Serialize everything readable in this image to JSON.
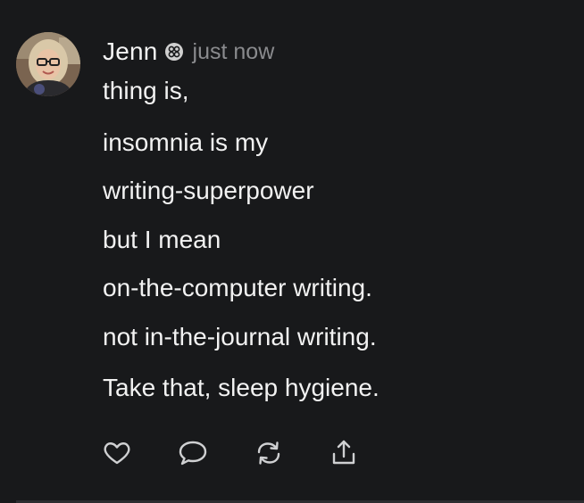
{
  "post": {
    "author": "Jenn",
    "badge_icon": "verified-badge-icon",
    "timestamp": "just now",
    "lines": [
      "thing is,",
      "insomnia is my",
      "writing-superpower",
      "but I mean",
      "on-the-computer writing.",
      "not in-the-journal writing.",
      "Take that, sleep hygiene."
    ]
  },
  "actions": [
    {
      "name": "like",
      "icon": "heart-icon"
    },
    {
      "name": "reply",
      "icon": "speech-bubble-icon"
    },
    {
      "name": "repost",
      "icon": "repost-icon"
    },
    {
      "name": "share",
      "icon": "share-icon"
    }
  ],
  "colors": {
    "background": "#18191b",
    "text": "#f2f2f2",
    "muted": "#8a8b8e",
    "icon": "#cfd0d2"
  }
}
